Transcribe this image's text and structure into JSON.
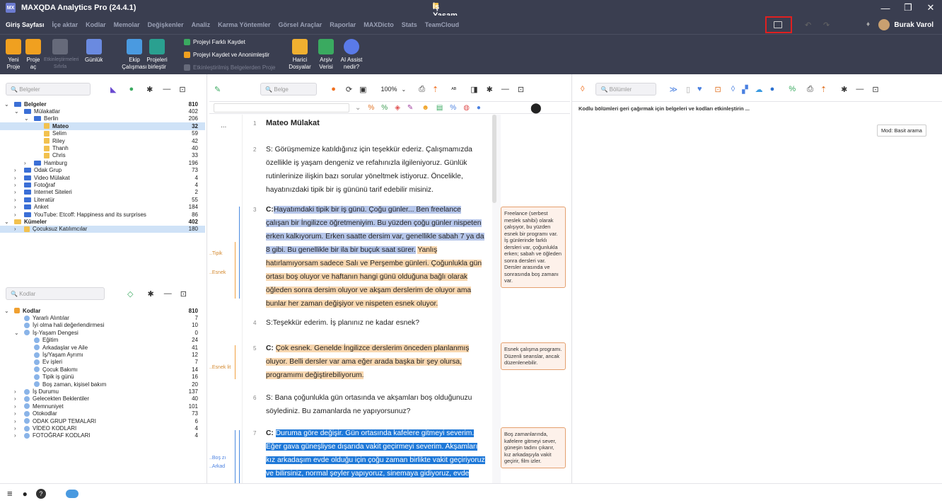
{
  "title": {
    "app": "MAXQDA Analytics Pro (24.4.1)",
    "doc": "İş Yaşam Dengesi"
  },
  "menu": [
    "Giriş Sayfası",
    "İçe aktar",
    "Kodlar",
    "Memolar",
    "Değişkenler",
    "Analiz",
    "Karma Yöntemler",
    "Görsel Araçlar",
    "Raporlar",
    "MAXDicto",
    "Stats",
    "TeamCloud"
  ],
  "user": "Burak Varol",
  "ribbon": {
    "yeni": "Yeni Proje",
    "proje": "Proje aç",
    "etk": "Etkinleştirmeleri Sıfırla",
    "gunluk": "Günlük",
    "ekip": "Ekip Çalışması",
    "projeleri": "Projeleri birleştir",
    "farkli": "Projeyi Farklı Kaydet",
    "anonim": "Projeyi Kaydet ve Anonimleştir",
    "etkb": "Etkinleştirilmiş Belgelerden Proje",
    "harici": "Harici Dosyalar",
    "arsiv": "Arşiv Verisi",
    "ai": "AI Assist nedir?"
  },
  "docs": {
    "search": "Belgeler",
    "rows": [
      {
        "t": "Belgeler",
        "c": "810",
        "lvl": 0,
        "type": "root",
        "bold": true,
        "exp": "v"
      },
      {
        "t": "Mülakatlar",
        "c": "402",
        "lvl": 1,
        "type": "folder",
        "exp": "v",
        "mk": "M"
      },
      {
        "t": "Berlin",
        "c": "206",
        "lvl": 2,
        "type": "folder",
        "exp": "v"
      },
      {
        "t": "Mateo",
        "c": "32",
        "lvl": 3,
        "type": "doc",
        "bold": true,
        "sel": true
      },
      {
        "t": "Selim",
        "c": "59",
        "lvl": 3,
        "type": "doc"
      },
      {
        "t": "Riley",
        "c": "42",
        "lvl": 3,
        "type": "doc"
      },
      {
        "t": "Thanh",
        "c": "40",
        "lvl": 3,
        "type": "doc"
      },
      {
        "t": "Chris",
        "c": "33",
        "lvl": 3,
        "type": "doc"
      },
      {
        "t": "Hamburg",
        "c": "196",
        "lvl": 2,
        "type": "folder",
        "exp": ">"
      },
      {
        "t": "Odak Grup",
        "c": "73",
        "lvl": 1,
        "type": "folder",
        "exp": ">"
      },
      {
        "t": "Video Mülakat",
        "c": "4",
        "lvl": 1,
        "type": "folder",
        "exp": ">"
      },
      {
        "t": "Fotoğraf",
        "c": "4",
        "lvl": 1,
        "type": "folder",
        "exp": ">"
      },
      {
        "t": "Internet Siteleri",
        "c": "2",
        "lvl": 1,
        "type": "folder",
        "exp": ">"
      },
      {
        "t": "Literatür",
        "c": "55",
        "lvl": 1,
        "type": "folder",
        "exp": ">"
      },
      {
        "t": "Anket",
        "c": "184",
        "lvl": 1,
        "type": "folder",
        "exp": ">"
      },
      {
        "t": "YouTube: Etcoff: Happiness and its surprises",
        "c": "86",
        "lvl": 1,
        "type": "folder",
        "exp": ">"
      },
      {
        "t": "Kümeler",
        "c": "402",
        "lvl": 0,
        "type": "none",
        "bold": true,
        "exp": "v"
      },
      {
        "t": "Çocuksuz Katılımcılar",
        "c": "180",
        "lvl": 1,
        "type": "doc",
        "exp": ">",
        "hl": true
      }
    ]
  },
  "codes": {
    "search": "Kodlar",
    "rows": [
      {
        "t": "Kodlar",
        "c": "810",
        "lvl": 0,
        "bold": true,
        "exp": "v"
      },
      {
        "t": "Yararlı Alıntılar",
        "c": "7",
        "lvl": 1
      },
      {
        "t": "İyi olma hali değerlendirmesi",
        "c": "10",
        "lvl": 1
      },
      {
        "t": "İş-Yaşam Dengesi",
        "c": "0",
        "lvl": 1,
        "exp": "v"
      },
      {
        "t": "Eğitim",
        "c": "24",
        "lvl": 2
      },
      {
        "t": "Arkadaşlar ve Aile",
        "c": "41",
        "lvl": 2
      },
      {
        "t": "İş/Yaşam Ayrımı",
        "c": "12",
        "lvl": 2
      },
      {
        "t": "Ev işleri",
        "c": "7",
        "lvl": 2
      },
      {
        "t": "Çocuk Bakımı",
        "c": "14",
        "lvl": 2
      },
      {
        "t": "Tipik iş günü",
        "c": "16",
        "lvl": 2
      },
      {
        "t": "Boş zaman, kişisel bakım",
        "c": "20",
        "lvl": 2
      },
      {
        "t": "İş Durumu",
        "c": "137",
        "lvl": 1,
        "exp": ">"
      },
      {
        "t": "Gelecekten Beklentiler",
        "c": "40",
        "lvl": 1,
        "exp": ">"
      },
      {
        "t": "Memnuniyet",
        "c": "101",
        "lvl": 1,
        "exp": ">"
      },
      {
        "t": "Otokodlar",
        "c": "73",
        "lvl": 1,
        "exp": ">"
      },
      {
        "t": "ODAK GRUP TEMALARI",
        "c": "6",
        "lvl": 1,
        "exp": ">"
      },
      {
        "t": "VİDEO KODLARI",
        "c": "4",
        "lvl": 1,
        "exp": ">"
      },
      {
        "t": "FOTOĞRAF KODLARI",
        "c": "4",
        "lvl": 1,
        "exp": ">"
      }
    ]
  },
  "browser": {
    "search": "Belge",
    "zoom": "100%",
    "title": "Mateo Mülakat",
    "p2": "S: Görüşmemize katıldığınız için teşekkür ederiz. Çalışmamızda özellikle iş yaşam dengeniz ve refahınızla ilgileniyoruz. Günlük rutinlerinize ilişkin bazı sorular yöneltmek istiyoruz. Öncelikle, hayatınızdaki tipik bir iş gününü tarif edebilir misiniz.",
    "p3a": "C:",
    "p3": "Hayatımdaki tipik bir iş günü. Çoğu günler... Ben freelance çalışan bir İngilizce öğretmeniyim. Bu yüzden çoğu günler nispeten erken kalkıyorum. Erken saatte dersim var, genellikle sabah 7 ya da 8 gibi. Bu genellikle bir ila bir buçuk saat sürer.",
    "p3b": "Yanlış hatırlamıyorsam sadece Salı ve Perşembe günleri. Çoğunlukla gün ortası boş oluyor ve haftanın hangi günü olduğuna bağlı olarak öğleden sonra dersim oluyor ve akşam derslerim de oluyor ama bunlar her zaman değişiyor ve nispeten esnek oluyor.",
    "p4": "S:Teşekkür ederim. İş planınız ne kadar esnek?",
    "p5a": "C:",
    "p5": "Çok esnek. Genelde İngilizce derslerim önceden planlanmış oluyor. Belli dersler var ama eğer arada başka bir şey olursa, programımı değiştirebiliyorum.",
    "p6": "S: Bana çoğunlukla gün ortasında ve akşamları boş olduğunuzu söylediniz. Bu zamanlarda ne yapıyorsunuz?",
    "p7a": "C:",
    "p7": "Duruma göre değişir. Gün ortasında kafelere gitmeyi severim. Eğer gava güneşliyse dışarıda vakit geçirmeyi severim. Akşamları kız arkadaşım evde olduğu için çoğu zaman birlikte vakit geçiriyoruz ve bilirsiniz, normal şeyler yapıyoruz, sinemaya gidiyoruz, evde",
    "memo1": "Freelance (serbest meslek sahibi) olarak çalışıyor, bu yüzden esnek bir programı var. İş günlerinde farklı dersleri var, çoğunlukla erken; sabah ve öğleden sonra dersleri var. Dersler arasında ve sonrasında boş zamanı var.",
    "memo2": "Esnek çalışma programı. Düzenli seanslar, ancak düzenlenebilir.",
    "memo3": "Boş zamanlarında, kafelere gitmeyi sever, güneşin tadını çıkarır, kız arkadaşıyla vakit geçirir, film izler.",
    "codes": {
      "tipik": "..Tipik",
      "esnek": "..Esnek",
      "esnekilit": "..Esnek lit",
      "boszi": "..Boş zı",
      "arkad": "..Arkad"
    },
    "dots": "..."
  },
  "retrieved": {
    "search": "Bölümler",
    "msg": "Kodlu bölümleri geri çağırmak için belgeleri ve kodları etkinleştirin ...",
    "mode": "Mod: Basit arama"
  }
}
